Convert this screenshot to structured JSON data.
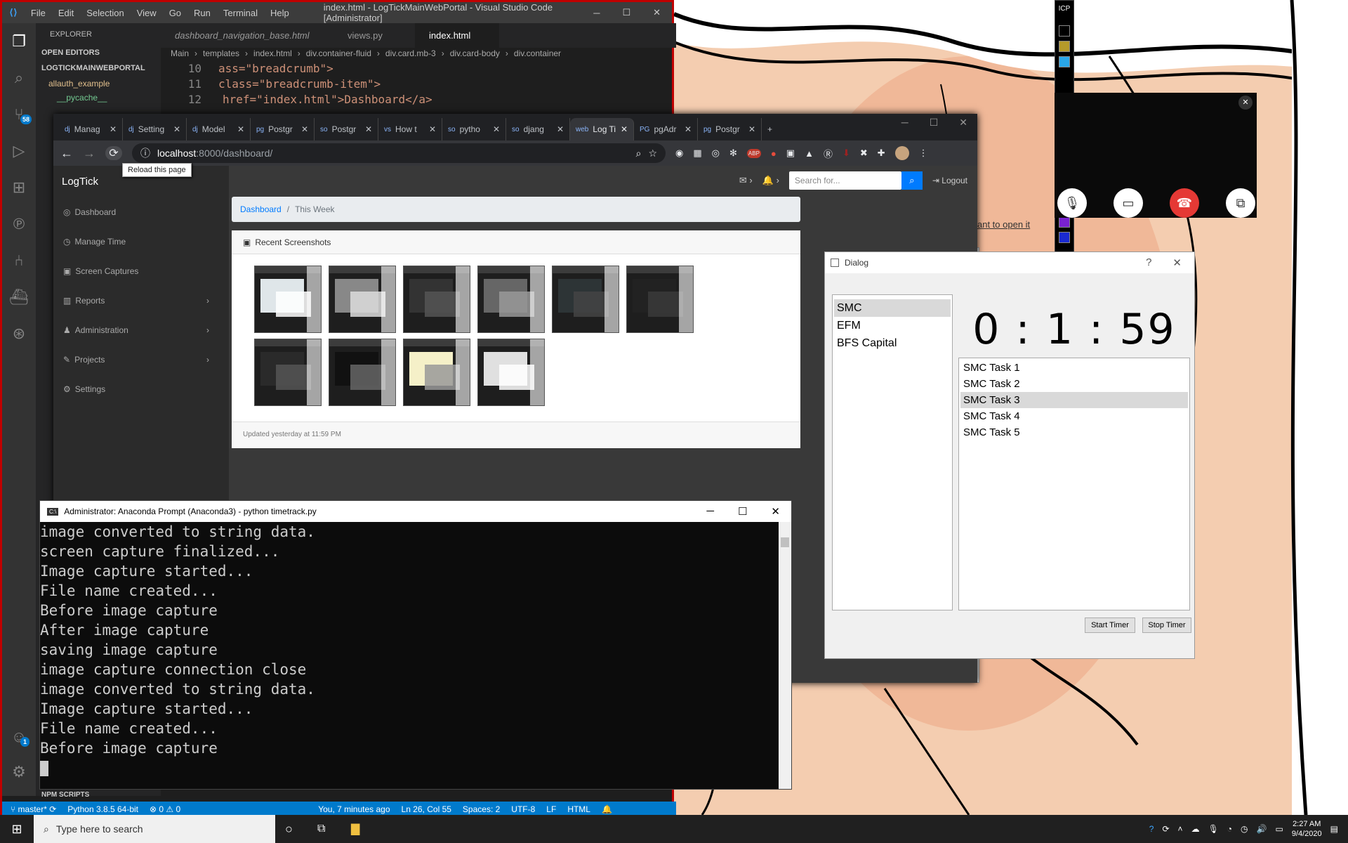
{
  "vscode": {
    "menus": [
      "File",
      "Edit",
      "Selection",
      "View",
      "Go",
      "Run",
      "Terminal",
      "Help"
    ],
    "title": "index.html - LogTickMainWebPortal - Visual Studio Code [Administrator]",
    "explorer_label": "EXPLORER",
    "open_editors": "OPEN EDITORS",
    "project": "LOGTICKMAINWEBPORTAL",
    "folders": [
      "allauth_example",
      "__pycache__"
    ],
    "npm_scripts": "NPM SCRIPTS",
    "source_control_badge": "58",
    "account_badge": "1",
    "tabs": [
      {
        "label": "dashboard_navigation_base.html"
      },
      {
        "label": "views.py"
      },
      {
        "label": "index.html"
      }
    ],
    "breadcrumb": [
      "Main",
      "templates",
      "index.html",
      "div.container-fluid",
      "div.card.mb-3",
      "div.card-body",
      "div.container"
    ],
    "code": [
      {
        "line": "10",
        "text": "ass=\"breadcrumb\">"
      },
      {
        "line": "11",
        "text": "class=\"breadcrumb-item\">"
      },
      {
        "line": "12",
        "text": "href=\"index.html\">Dashboard</a>"
      }
    ],
    "status": {
      "branch": "master*",
      "python": "Python 3.8.5 64-bit",
      "problems": "0",
      "warnings": "0",
      "blame": "You, 7 minutes ago",
      "position": "Ln 26, Col 55",
      "spaces": "Spaces: 2",
      "encoding": "UTF-8",
      "eol": "LF",
      "language": "HTML"
    }
  },
  "chrome": {
    "tabs": [
      {
        "icon": "dj",
        "label": "Manag"
      },
      {
        "icon": "dj",
        "label": "Setting"
      },
      {
        "icon": "dj",
        "label": "Model"
      },
      {
        "icon": "pg",
        "label": "Postgr"
      },
      {
        "icon": "so",
        "label": "Postgr"
      },
      {
        "icon": "vs",
        "label": "How t"
      },
      {
        "icon": "so",
        "label": "pytho"
      },
      {
        "icon": "so",
        "label": "djang"
      },
      {
        "icon": "web",
        "label": "Log Ti"
      },
      {
        "icon": "PG",
        "label": "pgAdr"
      },
      {
        "icon": "pg",
        "label": "Postgr"
      }
    ],
    "url_host": "localhost",
    "url_path": ":8000/dashboard/",
    "tooltip": "Reload this page"
  },
  "logtick": {
    "brand": "LogTick",
    "nav": [
      {
        "icon": "◎",
        "label": "Dashboard",
        "has_arrow": false
      },
      {
        "icon": "◷",
        "label": "Manage Time",
        "has_arrow": false
      },
      {
        "icon": "▣",
        "label": "Screen Captures",
        "has_arrow": false
      },
      {
        "icon": "▥",
        "label": "Reports",
        "has_arrow": true
      },
      {
        "icon": "♟",
        "label": "Administration",
        "has_arrow": true
      },
      {
        "icon": "✎",
        "label": "Projects",
        "has_arrow": true
      },
      {
        "icon": "⚙",
        "label": "Settings",
        "has_arrow": false
      }
    ],
    "search_placeholder": "Search for...",
    "logout": "Logout",
    "breadcrumb_home": "Dashboard",
    "breadcrumb_current": "This Week",
    "card_title": "Recent Screenshots",
    "card_footer": "Updated yesterday at 11:59 PM",
    "thumbnail_count": 10
  },
  "conda": {
    "title": "Administrator: Anaconda Prompt (Anaconda3) - python  timetrack.py",
    "lines": [
      "image converted to string data.",
      "screen capture finalized...",
      "Image capture started...",
      "File name created...",
      "Before image capture",
      "After image capture",
      "saving image capture",
      "image capture connection close",
      "image converted to string data.",
      "Image capture started...",
      "File name created...",
      "Before image capture"
    ]
  },
  "dialog": {
    "title": "Dialog",
    "help": "?",
    "clients": [
      "SMC",
      "EFM",
      "BFS Capital"
    ],
    "selected_client": 0,
    "timer": "0 : 1 : 59",
    "tasks": [
      "SMC Task 1",
      "SMC Task 2",
      "SMC Task 3",
      "SMC Task 4",
      "SMC Task 5"
    ],
    "selected_task": 2,
    "start_label": "Start Timer",
    "stop_label": "Stop Timer"
  },
  "background_link": "ant to open it",
  "paint_label": "ICP",
  "taskbar": {
    "search_placeholder": "Type here to search",
    "time": "2:27 AM",
    "date": "9/4/2020"
  }
}
